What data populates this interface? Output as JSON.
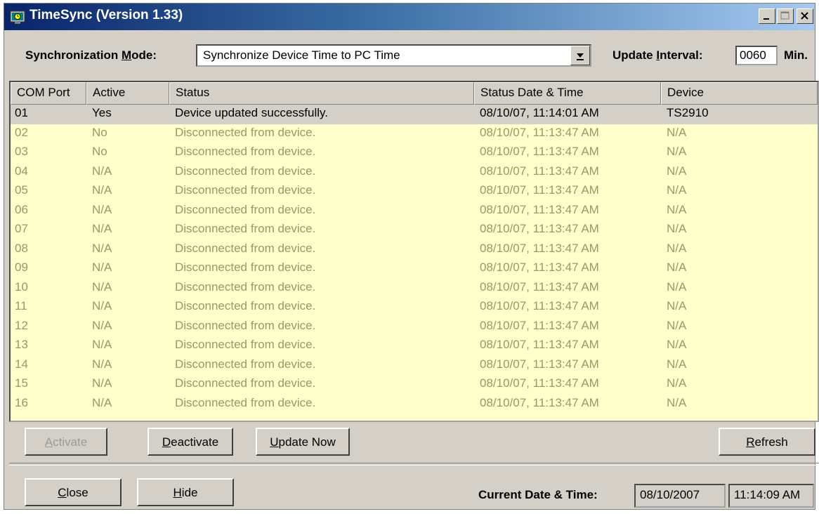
{
  "window": {
    "title": "TimeSync (Version 1.33)"
  },
  "sync_mode": {
    "label_pre": "Synchronization ",
    "label_key": "M",
    "label_post": "ode:",
    "value": "Synchronize Device Time to PC Time"
  },
  "update_interval": {
    "label_pre": "Update ",
    "label_key": "I",
    "label_post": "nterval:",
    "value": "0060",
    "unit": "Min."
  },
  "table": {
    "columns": [
      "COM Port",
      "Active",
      "Status",
      "Status Date & Time",
      "Device"
    ],
    "rows": [
      [
        "01",
        "Yes",
        "Device updated successfully.",
        "08/10/07, 11:14:01 AM",
        "TS2910"
      ],
      [
        "02",
        "No",
        "Disconnected from device.",
        "08/10/07, 11:13:47 AM",
        "N/A"
      ],
      [
        "03",
        "No",
        "Disconnected from device.",
        "08/10/07, 11:13:47 AM",
        "N/A"
      ],
      [
        "04",
        "N/A",
        "Disconnected from device.",
        "08/10/07, 11:13:47 AM",
        "N/A"
      ],
      [
        "05",
        "N/A",
        "Disconnected from device.",
        "08/10/07, 11:13:47 AM",
        "N/A"
      ],
      [
        "06",
        "N/A",
        "Disconnected from device.",
        "08/10/07, 11:13:47 AM",
        "N/A"
      ],
      [
        "07",
        "N/A",
        "Disconnected from device.",
        "08/10/07, 11:13:47 AM",
        "N/A"
      ],
      [
        "08",
        "N/A",
        "Disconnected from device.",
        "08/10/07, 11:13:47 AM",
        "N/A"
      ],
      [
        "09",
        "N/A",
        "Disconnected from device.",
        "08/10/07, 11:13:47 AM",
        "N/A"
      ],
      [
        "10",
        "N/A",
        "Disconnected from device.",
        "08/10/07, 11:13:47 AM",
        "N/A"
      ],
      [
        "11",
        "N/A",
        "Disconnected from device.",
        "08/10/07, 11:13:47 AM",
        "N/A"
      ],
      [
        "12",
        "N/A",
        "Disconnected from device.",
        "08/10/07, 11:13:47 AM",
        "N/A"
      ],
      [
        "13",
        "N/A",
        "Disconnected from device.",
        "08/10/07, 11:13:47 AM",
        "N/A"
      ],
      [
        "14",
        "N/A",
        "Disconnected from device.",
        "08/10/07, 11:13:47 AM",
        "N/A"
      ],
      [
        "15",
        "N/A",
        "Disconnected from device.",
        "08/10/07, 11:13:47 AM",
        "N/A"
      ],
      [
        "16",
        "N/A",
        "Disconnected from device.",
        "08/10/07, 11:13:47 AM",
        "N/A"
      ]
    ],
    "selected_row": 0
  },
  "buttons": {
    "activate": {
      "key": "A",
      "rest": "ctivate"
    },
    "deactivate": {
      "key": "D",
      "rest": "eactivate"
    },
    "update_now": {
      "key": "U",
      "rest": "pdate Now"
    },
    "refresh": {
      "key": "R",
      "rest": "efresh"
    },
    "close": {
      "key": "C",
      "rest": "lose"
    },
    "hide": {
      "key": "H",
      "rest": "ide"
    }
  },
  "current": {
    "label": "Current Date & Time:",
    "date": "08/10/2007",
    "time": "11:14:09 AM"
  },
  "colors": {
    "list_bg": "#ffffcc",
    "inactive_text": "#999966",
    "title_start": "#0a246a",
    "title_end": "#a6caf0",
    "face": "#d4d0c8"
  }
}
